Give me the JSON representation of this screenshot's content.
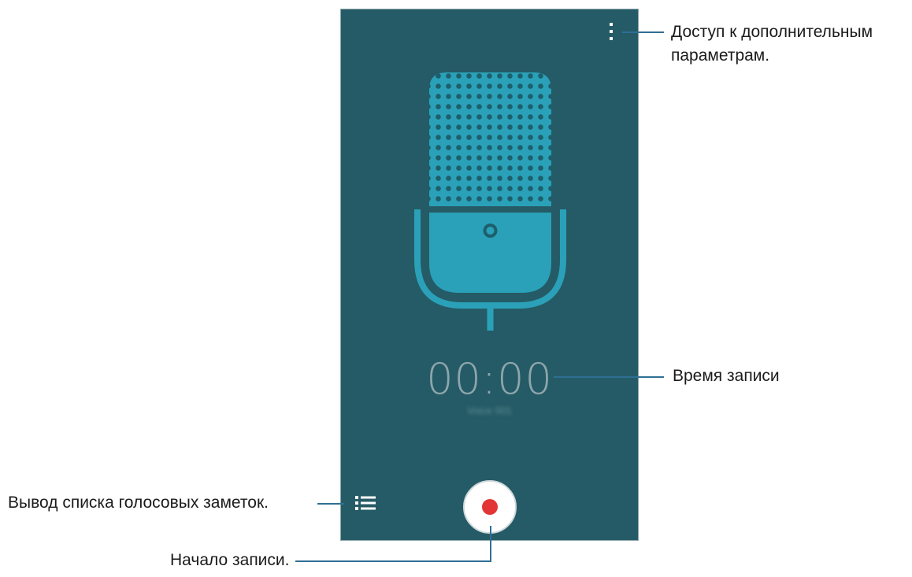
{
  "screen": {
    "timer": "00:00",
    "filename": "Voice 001"
  },
  "colors": {
    "background": "#255b66",
    "mic": "#2aa1b8",
    "record_dot": "#e23636",
    "leader_line": "#2f6f95"
  },
  "icons": {
    "menu": "more-options-icon",
    "list": "recordings-list-icon",
    "record": "record-icon",
    "microphone": "microphone-icon"
  },
  "callouts": {
    "options_line1": "Доступ к дополнительным",
    "options_line2": "параметрам.",
    "recording_time": "Время записи",
    "list": "Вывод списка голосовых заметок.",
    "start": "Начало записи."
  }
}
